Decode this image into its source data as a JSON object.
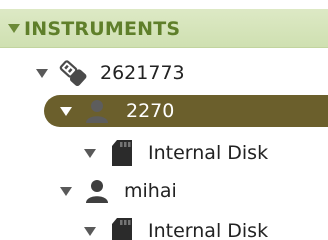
{
  "tree": {
    "section_title": "INSTRUMENTS",
    "nodes": [
      {
        "label": "2621773",
        "icon": "usb-key-icon"
      },
      {
        "label": "2270",
        "icon": "user-icon",
        "selected": true
      },
      {
        "label": "Internal Disk",
        "icon": "sd-card-icon"
      },
      {
        "label": "mihai",
        "icon": "user-icon"
      },
      {
        "label": "Internal Disk",
        "icon": "sd-card-icon"
      }
    ]
  },
  "colors": {
    "header_bg": "#d6e5bb",
    "header_text": "#5f7f2a",
    "selected_bg": "#6b5f2c",
    "selected_text": "#ffffff",
    "text": "#222222",
    "icon": "#4a4a4a"
  }
}
